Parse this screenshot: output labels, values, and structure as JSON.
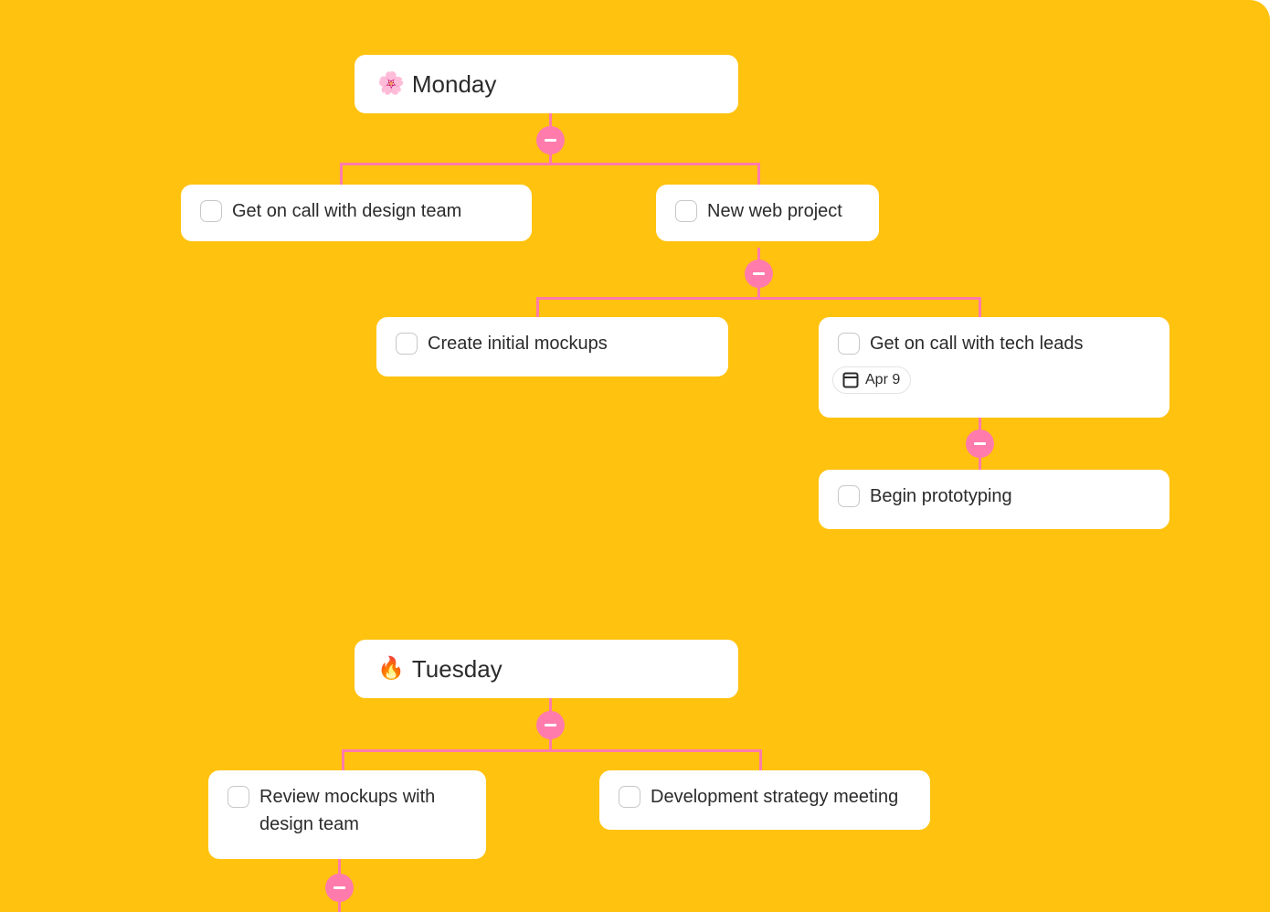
{
  "colors": {
    "background": "#FFC20E",
    "connector": "#FF7BAC",
    "card": "#FFFFFF",
    "text": "#2B2B2B"
  },
  "days": [
    {
      "title": "Monday",
      "emoji": "🌸",
      "emoji_name": "cherry-blossom-icon",
      "tasks": [
        {
          "label": "Get on call with design team",
          "checked": false
        },
        {
          "label": "New web project",
          "checked": false,
          "subtasks": [
            {
              "label": "Create initial mockups",
              "checked": false
            },
            {
              "label": "Get on call with tech leads",
              "checked": false,
              "due_date": "Apr 9",
              "subtasks": [
                {
                  "label": "Begin prototyping",
                  "checked": false
                }
              ]
            }
          ]
        }
      ]
    },
    {
      "title": "Tuesday",
      "emoji": "🔥",
      "emoji_name": "fire-icon",
      "tasks": [
        {
          "label": "Review mockups with design team",
          "checked": false,
          "collapsed_children": true
        },
        {
          "label": "Development strategy meeting",
          "checked": false
        }
      ]
    }
  ],
  "toggle_symbol": "collapse"
}
